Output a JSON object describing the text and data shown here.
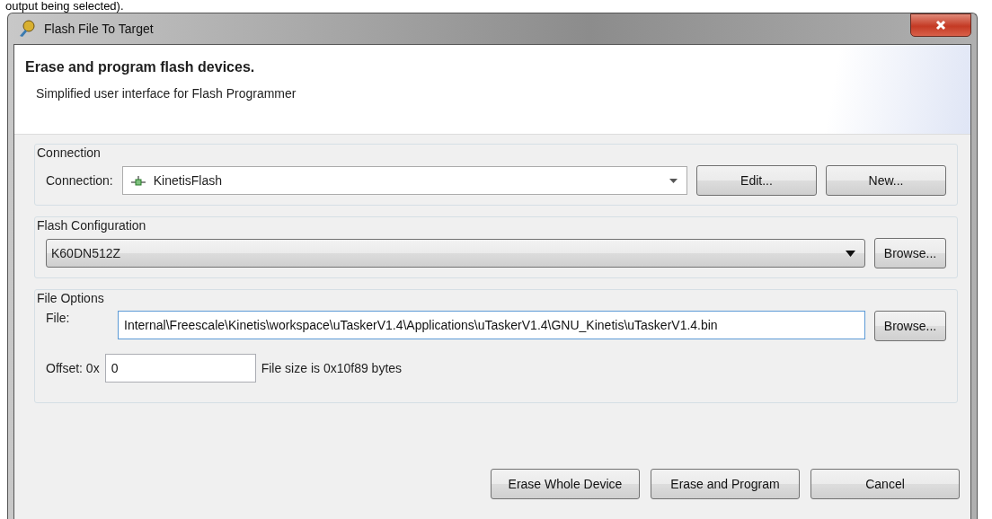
{
  "page_caption": "output being selected).",
  "window": {
    "title": "Flash File To Target"
  },
  "header": {
    "title": "Erase and program flash devices.",
    "description": "Simplified user interface for Flash Programmer"
  },
  "connection": {
    "title": "Connection",
    "label": "Connection:",
    "value": "KinetisFlash",
    "buttons": [
      "Edit...",
      "New..."
    ]
  },
  "flash_configuration": {
    "title": "Flash Configuration",
    "value": "K60DN512Z",
    "button": "Browse..."
  },
  "file_options": {
    "title": "File Options",
    "file_label": "File:",
    "file_value": "Internal\\Freescale\\Kinetis\\workspace\\uTaskerV1.4\\Applications\\uTaskerV1.4\\GNU_Kinetis\\uTaskerV1.4.bin",
    "file_button": "Browse...",
    "offset_label": "Offset: 0x",
    "offset_value": "0",
    "size_text": "File size is 0x10f89 bytes"
  },
  "buttons": [
    "Erase Whole Device",
    "Erase and Program",
    "Cancel"
  ]
}
